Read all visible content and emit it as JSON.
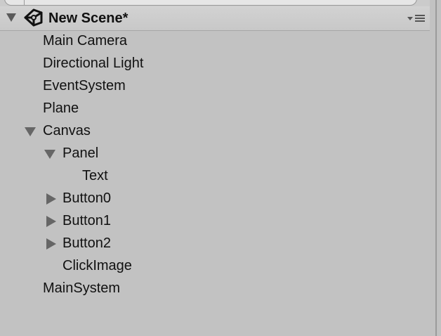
{
  "scene": {
    "title": "New Scene*"
  },
  "hierarchy": {
    "items": [
      {
        "label": "Main Camera"
      },
      {
        "label": "Directional Light"
      },
      {
        "label": "EventSystem"
      },
      {
        "label": "Plane"
      },
      {
        "label": "Canvas"
      },
      {
        "label": "Panel"
      },
      {
        "label": "Text"
      },
      {
        "label": "Button0"
      },
      {
        "label": "Button1"
      },
      {
        "label": "Button2"
      },
      {
        "label": "ClickImage"
      },
      {
        "label": "MainSystem"
      }
    ]
  },
  "colors": {
    "background": "#c2c2c2",
    "header": "#cbcbcb",
    "text": "#111111",
    "foldout_triangle": "#666666"
  },
  "icons": {
    "scene": "unity-logo-icon",
    "scene_menu": "context-menu-icon",
    "expanded": "triangle-down-icon",
    "collapsed": "triangle-right-icon"
  }
}
